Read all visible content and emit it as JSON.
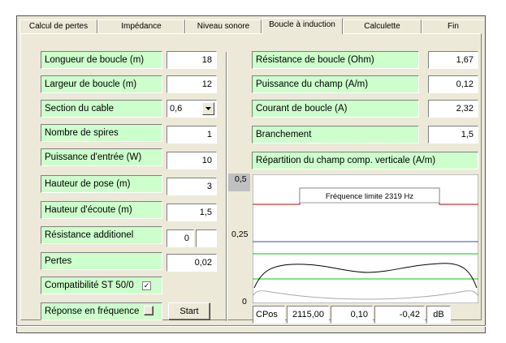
{
  "tabs": [
    "Calcul de pertes",
    "Impédance",
    "Niveau sonore",
    "Boucle à induction",
    "Calculette",
    "Fin"
  ],
  "active_tab": "Boucle à induction",
  "left": {
    "longueur": {
      "label": "Longueur de boucle (m)",
      "value": "18"
    },
    "largeur": {
      "label": "Largeur de boucle (m)",
      "value": "12"
    },
    "section": {
      "label": "Section du cable",
      "value": "0,6"
    },
    "spires": {
      "label": "Nombre de spires",
      "value": "1"
    },
    "puissance": {
      "label": "Puissance d'entrée (W)",
      "value": "10"
    },
    "hauteur_pose": {
      "label": "Hauteur de pose (m)",
      "value": "3"
    },
    "hauteur_ecoute": {
      "label": "Hauteur d'écoute (m)",
      "value": "1,5"
    },
    "resistance_add": {
      "label": "Résistance additionel",
      "value": "0",
      "value2": ""
    },
    "pertes": {
      "label": "Pertes",
      "value": "0,02"
    },
    "compat": {
      "label": "Compatibilité ST 50/0",
      "checked": true,
      "mark": "✓"
    },
    "reponse": {
      "label": "Réponse en fréquence",
      "checked": false
    },
    "start_label": "Start"
  },
  "right": {
    "resistance": {
      "label": "Résistance de boucle (Ohm)",
      "value": "1,67"
    },
    "puissance_champ": {
      "label": "Puissance du champ (A/m)",
      "value": "0,12"
    },
    "courant": {
      "label": "Courant de boucle (A)",
      "value": "2,32"
    },
    "branchement": {
      "label": "Branchement",
      "value": "1,5"
    },
    "repartition_title": "Répartition du champ comp. verticale (A/m)"
  },
  "chart_data": {
    "type": "line",
    "y_ticks": [
      "0,5",
      "0,25",
      "0"
    ],
    "freq_label": "Fréquence limite  2319  Hz",
    "colors": {
      "red": "#c00000",
      "blue": "#3344cc",
      "green": "#00cc00",
      "black": "#000000",
      "gray": "#aaaaaa"
    }
  },
  "status": {
    "cpos_label": "CPos",
    "cpos_value": "2115,00",
    "v1": "0,10",
    "v2": "-0,42",
    "unit": "dB"
  }
}
